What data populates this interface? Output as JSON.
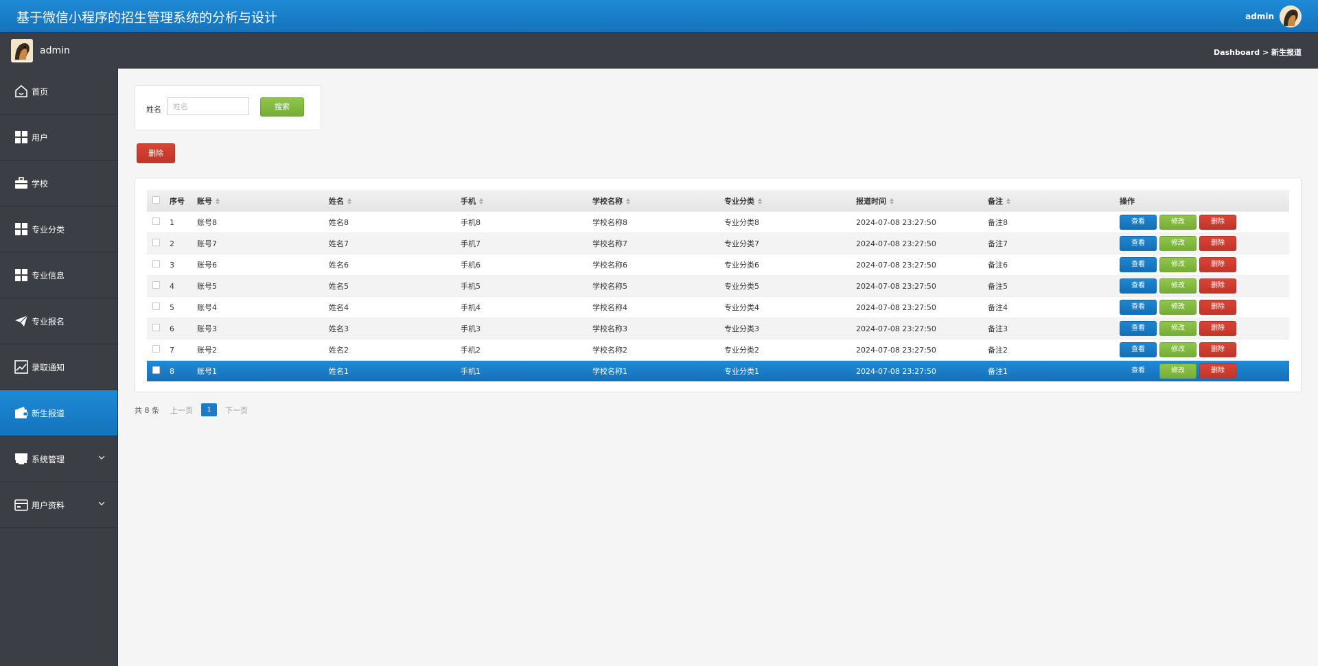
{
  "header": {
    "title": "基于微信小程序的招生管理系统的分析与设计",
    "user": "admin"
  },
  "userbar": {
    "user": "admin",
    "breadcrumb": "Dashboard > 新生报道"
  },
  "sidebar": {
    "items": [
      {
        "label": "首页",
        "icon": "home-icon"
      },
      {
        "label": "用户",
        "icon": "grid-icon"
      },
      {
        "label": "学校",
        "icon": "briefcase-icon"
      },
      {
        "label": "专业分类",
        "icon": "grid-icon"
      },
      {
        "label": "专业信息",
        "icon": "grid-icon"
      },
      {
        "label": "专业报名",
        "icon": "paper-plane-icon"
      },
      {
        "label": "录取通知",
        "icon": "chart-icon"
      },
      {
        "label": "新生报道",
        "icon": "wallet-icon",
        "active": true
      },
      {
        "label": "系统管理",
        "icon": "store-icon",
        "expandable": true
      },
      {
        "label": "用户资料",
        "icon": "card-icon",
        "expandable": true
      }
    ]
  },
  "search": {
    "label": "姓名",
    "placeholder": "姓名",
    "value": "",
    "button": "搜索"
  },
  "toolbar": {
    "delete_label": "删除"
  },
  "table": {
    "columns": [
      "序号",
      "账号",
      "姓名",
      "手机",
      "学校名称",
      "专业分类",
      "报道时间",
      "备注",
      "操作"
    ],
    "actions": {
      "view": "查看",
      "edit": "修改",
      "delete": "删除"
    },
    "rows": [
      {
        "no": "1",
        "account": "账号8",
        "name": "姓名8",
        "phone": "手机8",
        "school": "学校名称8",
        "major": "专业分类8",
        "time": "2024-07-08 23:27:50",
        "note": "备注8"
      },
      {
        "no": "2",
        "account": "账号7",
        "name": "姓名7",
        "phone": "手机7",
        "school": "学校名称7",
        "major": "专业分类7",
        "time": "2024-07-08 23:27:50",
        "note": "备注7"
      },
      {
        "no": "3",
        "account": "账号6",
        "name": "姓名6",
        "phone": "手机6",
        "school": "学校名称6",
        "major": "专业分类6",
        "time": "2024-07-08 23:27:50",
        "note": "备注6"
      },
      {
        "no": "4",
        "account": "账号5",
        "name": "姓名5",
        "phone": "手机5",
        "school": "学校名称5",
        "major": "专业分类5",
        "time": "2024-07-08 23:27:50",
        "note": "备注5"
      },
      {
        "no": "5",
        "account": "账号4",
        "name": "姓名4",
        "phone": "手机4",
        "school": "学校名称4",
        "major": "专业分类4",
        "time": "2024-07-08 23:27:50",
        "note": "备注4"
      },
      {
        "no": "6",
        "account": "账号3",
        "name": "姓名3",
        "phone": "手机3",
        "school": "学校名称3",
        "major": "专业分类3",
        "time": "2024-07-08 23:27:50",
        "note": "备注3"
      },
      {
        "no": "7",
        "account": "账号2",
        "name": "姓名2",
        "phone": "手机2",
        "school": "学校名称2",
        "major": "专业分类2",
        "time": "2024-07-08 23:27:50",
        "note": "备注2"
      },
      {
        "no": "8",
        "account": "账号1",
        "name": "姓名1",
        "phone": "手机1",
        "school": "学校名称1",
        "major": "专业分类1",
        "time": "2024-07-08 23:27:50",
        "note": "备注1",
        "selected": true
      }
    ]
  },
  "pager": {
    "total": "共 8 条",
    "prev": "上一页",
    "current": "1",
    "next": "下一页"
  },
  "colors": {
    "accent": "#1a7cc7",
    "sidebar": "#3b3f45",
    "green": "#7fb53e",
    "red": "#c9392c"
  }
}
